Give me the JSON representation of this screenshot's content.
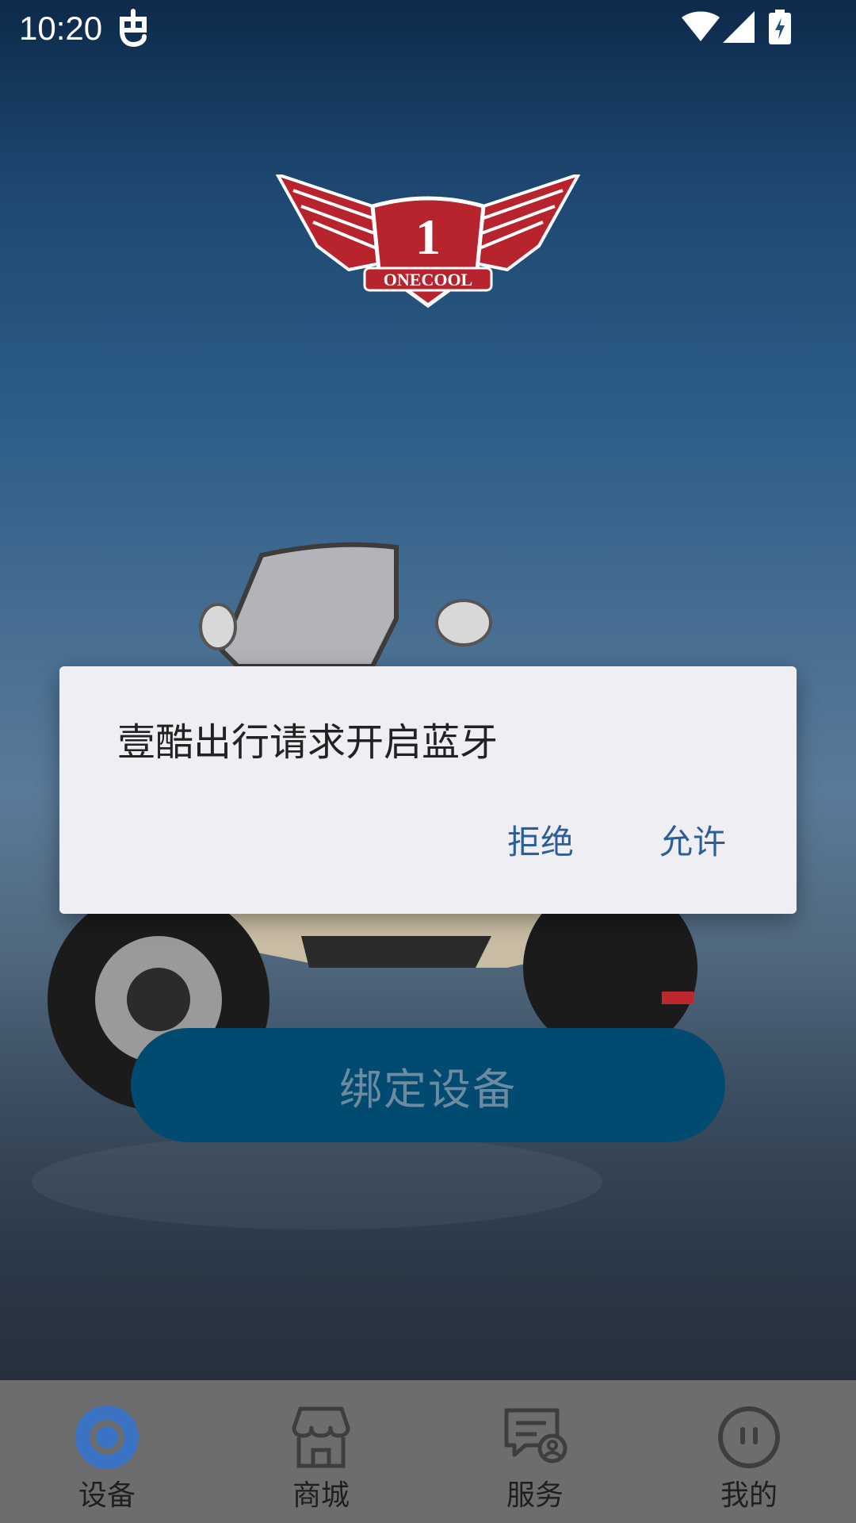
{
  "status_bar": {
    "time": "10:20",
    "icons": [
      "debug-icon",
      "wifi-icon",
      "signal-icon",
      "battery-charging-icon"
    ]
  },
  "logo": {
    "text": "ONECOOL",
    "number": "1"
  },
  "main": {
    "bind_button_label": "绑定设备"
  },
  "dialog": {
    "message": "壹酷出行请求开启蓝牙",
    "deny_label": "拒绝",
    "allow_label": "允许"
  },
  "bottom_nav": {
    "items": [
      {
        "label": "设备",
        "icon": "device-icon",
        "active": true
      },
      {
        "label": "商城",
        "icon": "store-icon",
        "active": false
      },
      {
        "label": "服务",
        "icon": "service-icon",
        "active": false
      },
      {
        "label": "我的",
        "icon": "profile-icon",
        "active": false
      }
    ]
  },
  "colors": {
    "accent": "#3a73c4",
    "dialog_button": "#2c5e9a",
    "bind_button": "#014a70"
  }
}
